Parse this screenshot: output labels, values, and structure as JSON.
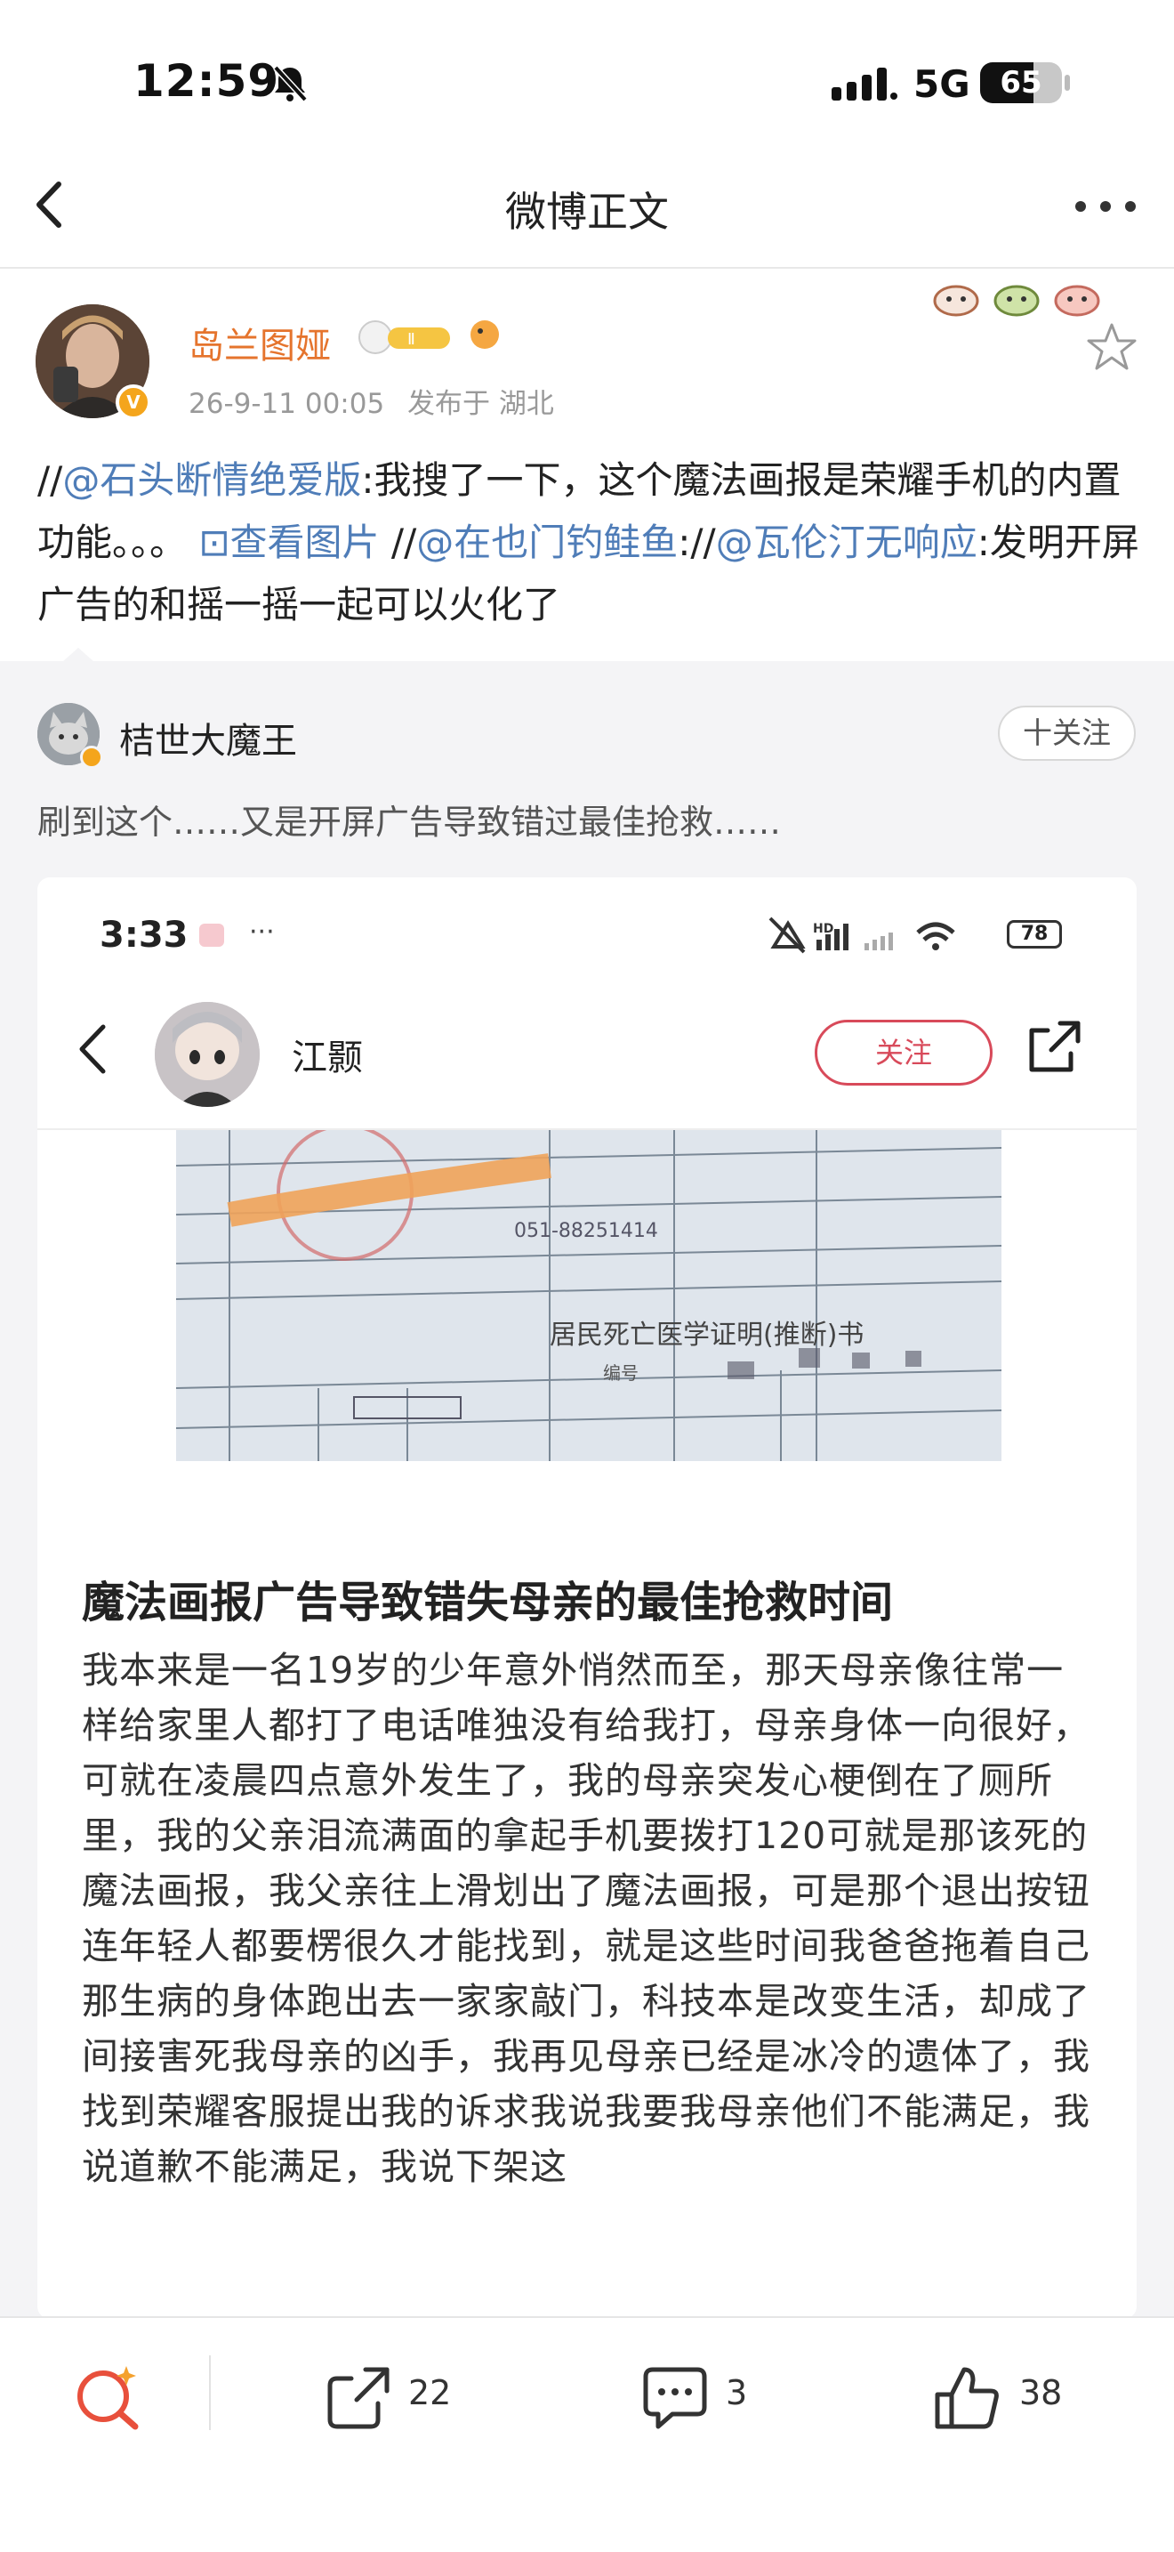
{
  "status_bar": {
    "time": "12:59",
    "network": "5G",
    "battery": "65",
    "battery_level": 0.65
  },
  "nav": {
    "title": "微博正文"
  },
  "post": {
    "author": "岛兰图娅",
    "date": "26-9-11 00:05",
    "location": "发布于 湖北",
    "text_segments": [
      {
        "text": "//",
        "link": false
      },
      {
        "text": "@石头断情绝爱版",
        "link": true
      },
      {
        "text": ":我搜了一下，这个魔法画报是荣耀手机的内置功能。。。 ",
        "link": false
      },
      {
        "text": "⊡查看图片",
        "link": true
      },
      {
        "text": " //",
        "link": false
      },
      {
        "text": "@在也门钓鲑鱼",
        "link": true
      },
      {
        "text": "://",
        "link": false
      },
      {
        "text": "@瓦伦汀无响应",
        "link": true
      },
      {
        "text": ":发明开屏广告的和摇一摇一起可以火化了",
        "link": false
      }
    ]
  },
  "original": {
    "author": "桔世大魔王",
    "follow_label": "十关注",
    "text": "刷到这个……又是开屏广告导致错过最佳抢救……",
    "embed": {
      "time": "3:33",
      "dots": "···",
      "battery": "78",
      "username": "江颢",
      "follow_label": "关注",
      "doc_texts": [
        "居民死亡医学证明(推断)书",
        "051-88251414",
        "编号"
      ],
      "headline": "魔法画报广告导致错失母亲的最佳抢救时间",
      "body": "我本来是一名19岁的少年意外悄然而至，那天母亲像往常一样给家里人都打了电话唯独没有给我打，母亲身体一向很好，可就在凌晨四点意外发生了，我的母亲突发心梗倒在了厕所里，我的父亲泪流满面的拿起手机要拨打120可就是那该死的魔法画报，我父亲往上滑划出了魔法画报，可是那个退出按钮连年轻人都要楞很久才能找到，就是这些时间我爸爸拖着自己那生病的身体跑出去一家家敲门，科技本是改变生活，却成了间接害死我母亲的凶手，我再见母亲已经是冰冷的遗体了，我找到荣耀客服提出我的诉求我说我要我母亲他们不能满足，我说道歉不能满足，我说下架这"
    }
  },
  "actions": {
    "repost_count": "22",
    "comment_count": "3",
    "like_count": "38"
  },
  "colors": {
    "author_orange": "#e5742d",
    "link_blue": "#4f7db8",
    "follow_red": "#d84a5a"
  }
}
